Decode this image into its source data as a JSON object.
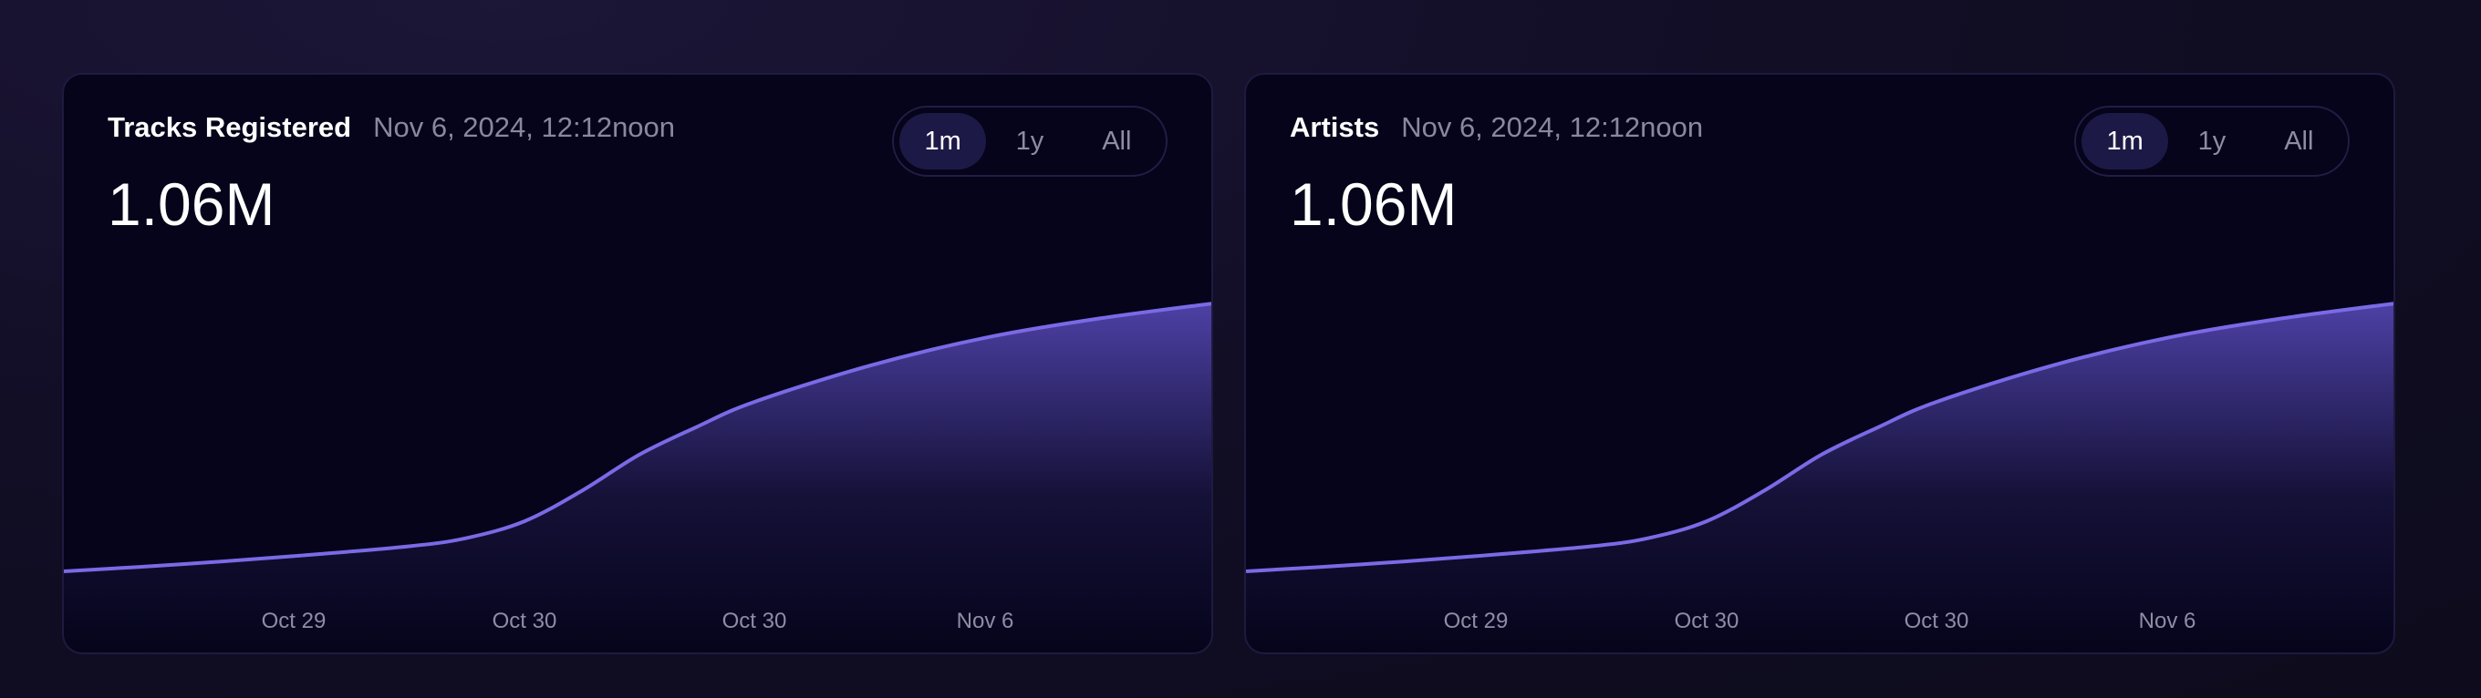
{
  "colors": {
    "line": "#7a6ae6",
    "fill": "#5a4bbd",
    "card_bg": "#05041a",
    "active_toggle": "#1d1946"
  },
  "cards": [
    {
      "title": "Tracks Registered",
      "timestamp": "Nov 6, 2024, 12:12noon",
      "value": "1.06M",
      "toggle": [
        "1m",
        "1y",
        "All"
      ],
      "active_toggle": "1m"
    },
    {
      "title": "Artists",
      "timestamp": "Nov 6, 2024, 12:12noon",
      "value": "1.06M",
      "toggle": [
        "1m",
        "1y",
        "All"
      ],
      "active_toggle": "1m"
    }
  ],
  "chart_data": [
    {
      "type": "area",
      "xlabel": "",
      "ylabel": "",
      "x_ticks": [
        "Oct 29",
        "Oct 30",
        "Oct 30",
        "Nov 6"
      ],
      "y_hidden": true,
      "series": [
        {
          "x": [
            0,
            0.1,
            0.2,
            0.3,
            0.35,
            0.4,
            0.45,
            0.5,
            0.55,
            0.6,
            0.7,
            0.8,
            0.9,
            1.0
          ],
          "y": [
            0.0,
            0.025,
            0.055,
            0.09,
            0.12,
            0.18,
            0.29,
            0.42,
            0.52,
            0.61,
            0.74,
            0.84,
            0.91,
            0.965
          ]
        }
      ]
    },
    {
      "type": "area",
      "xlabel": "",
      "ylabel": "",
      "x_ticks": [
        "Oct 29",
        "Oct 30",
        "Oct 30",
        "Nov 6"
      ],
      "y_hidden": true,
      "series": [
        {
          "x": [
            0,
            0.1,
            0.2,
            0.3,
            0.35,
            0.4,
            0.45,
            0.5,
            0.55,
            0.6,
            0.7,
            0.8,
            0.9,
            1.0
          ],
          "y": [
            0.0,
            0.025,
            0.055,
            0.09,
            0.12,
            0.18,
            0.29,
            0.42,
            0.52,
            0.61,
            0.74,
            0.84,
            0.91,
            0.965
          ]
        }
      ]
    }
  ]
}
